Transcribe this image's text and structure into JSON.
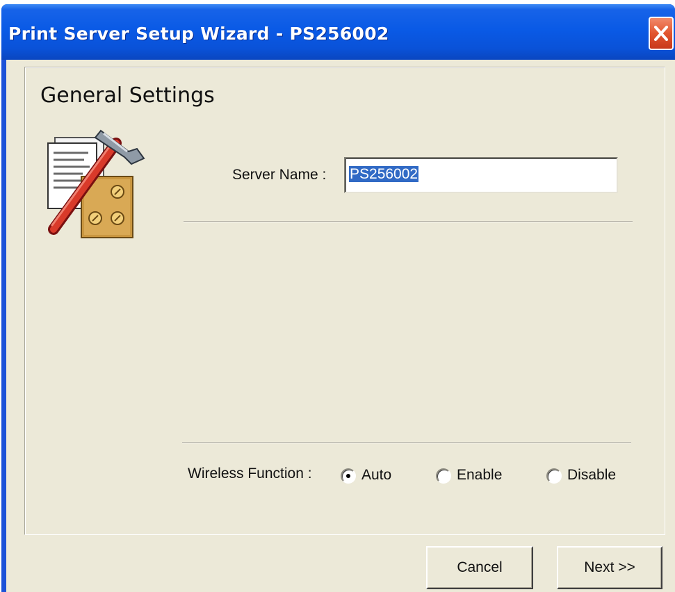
{
  "window": {
    "title": "Print Server Setup Wizard - PS256002",
    "close_icon": "close-icon"
  },
  "page": {
    "heading": "General Settings",
    "icon": "settings-hammer-icon"
  },
  "server_name": {
    "label": "Server Name :",
    "value": "PS256002"
  },
  "wireless": {
    "label": "Wireless Function :",
    "options": [
      {
        "label": "Auto",
        "selected": true
      },
      {
        "label": "Enable",
        "selected": false
      },
      {
        "label": "Disable",
        "selected": false
      }
    ]
  },
  "buttons": {
    "cancel": "Cancel",
    "next": "Next >>"
  },
  "colors": {
    "title_bar": "#0a52d8",
    "selection": "#316ac5",
    "dialog_bg": "#ece9d8",
    "close_button": "#e2552f"
  }
}
